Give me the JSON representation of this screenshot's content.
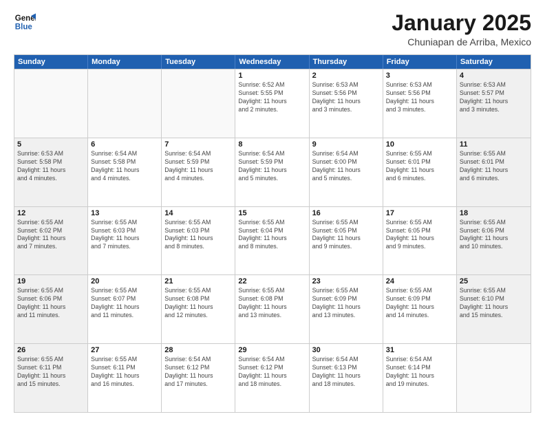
{
  "header": {
    "logo_line1": "General",
    "logo_line2": "Blue",
    "title": "January 2025",
    "subtitle": "Chuniapan de Arriba, Mexico"
  },
  "days_of_week": [
    "Sunday",
    "Monday",
    "Tuesday",
    "Wednesday",
    "Thursday",
    "Friday",
    "Saturday"
  ],
  "weeks": [
    [
      {
        "day": "",
        "info": "",
        "empty": true
      },
      {
        "day": "",
        "info": "",
        "empty": true
      },
      {
        "day": "",
        "info": "",
        "empty": true
      },
      {
        "day": "1",
        "info": "Sunrise: 6:52 AM\nSunset: 5:55 PM\nDaylight: 11 hours\nand 2 minutes."
      },
      {
        "day": "2",
        "info": "Sunrise: 6:53 AM\nSunset: 5:56 PM\nDaylight: 11 hours\nand 3 minutes."
      },
      {
        "day": "3",
        "info": "Sunrise: 6:53 AM\nSunset: 5:56 PM\nDaylight: 11 hours\nand 3 minutes."
      },
      {
        "day": "4",
        "info": "Sunrise: 6:53 AM\nSunset: 5:57 PM\nDaylight: 11 hours\nand 3 minutes."
      }
    ],
    [
      {
        "day": "5",
        "info": "Sunrise: 6:53 AM\nSunset: 5:58 PM\nDaylight: 11 hours\nand 4 minutes."
      },
      {
        "day": "6",
        "info": "Sunrise: 6:54 AM\nSunset: 5:58 PM\nDaylight: 11 hours\nand 4 minutes."
      },
      {
        "day": "7",
        "info": "Sunrise: 6:54 AM\nSunset: 5:59 PM\nDaylight: 11 hours\nand 4 minutes."
      },
      {
        "day": "8",
        "info": "Sunrise: 6:54 AM\nSunset: 5:59 PM\nDaylight: 11 hours\nand 5 minutes."
      },
      {
        "day": "9",
        "info": "Sunrise: 6:54 AM\nSunset: 6:00 PM\nDaylight: 11 hours\nand 5 minutes."
      },
      {
        "day": "10",
        "info": "Sunrise: 6:55 AM\nSunset: 6:01 PM\nDaylight: 11 hours\nand 6 minutes."
      },
      {
        "day": "11",
        "info": "Sunrise: 6:55 AM\nSunset: 6:01 PM\nDaylight: 11 hours\nand 6 minutes."
      }
    ],
    [
      {
        "day": "12",
        "info": "Sunrise: 6:55 AM\nSunset: 6:02 PM\nDaylight: 11 hours\nand 7 minutes."
      },
      {
        "day": "13",
        "info": "Sunrise: 6:55 AM\nSunset: 6:03 PM\nDaylight: 11 hours\nand 7 minutes."
      },
      {
        "day": "14",
        "info": "Sunrise: 6:55 AM\nSunset: 6:03 PM\nDaylight: 11 hours\nand 8 minutes."
      },
      {
        "day": "15",
        "info": "Sunrise: 6:55 AM\nSunset: 6:04 PM\nDaylight: 11 hours\nand 8 minutes."
      },
      {
        "day": "16",
        "info": "Sunrise: 6:55 AM\nSunset: 6:05 PM\nDaylight: 11 hours\nand 9 minutes."
      },
      {
        "day": "17",
        "info": "Sunrise: 6:55 AM\nSunset: 6:05 PM\nDaylight: 11 hours\nand 9 minutes."
      },
      {
        "day": "18",
        "info": "Sunrise: 6:55 AM\nSunset: 6:06 PM\nDaylight: 11 hours\nand 10 minutes."
      }
    ],
    [
      {
        "day": "19",
        "info": "Sunrise: 6:55 AM\nSunset: 6:06 PM\nDaylight: 11 hours\nand 11 minutes."
      },
      {
        "day": "20",
        "info": "Sunrise: 6:55 AM\nSunset: 6:07 PM\nDaylight: 11 hours\nand 11 minutes."
      },
      {
        "day": "21",
        "info": "Sunrise: 6:55 AM\nSunset: 6:08 PM\nDaylight: 11 hours\nand 12 minutes."
      },
      {
        "day": "22",
        "info": "Sunrise: 6:55 AM\nSunset: 6:08 PM\nDaylight: 11 hours\nand 13 minutes."
      },
      {
        "day": "23",
        "info": "Sunrise: 6:55 AM\nSunset: 6:09 PM\nDaylight: 11 hours\nand 13 minutes."
      },
      {
        "day": "24",
        "info": "Sunrise: 6:55 AM\nSunset: 6:09 PM\nDaylight: 11 hours\nand 14 minutes."
      },
      {
        "day": "25",
        "info": "Sunrise: 6:55 AM\nSunset: 6:10 PM\nDaylight: 11 hours\nand 15 minutes."
      }
    ],
    [
      {
        "day": "26",
        "info": "Sunrise: 6:55 AM\nSunset: 6:11 PM\nDaylight: 11 hours\nand 15 minutes."
      },
      {
        "day": "27",
        "info": "Sunrise: 6:55 AM\nSunset: 6:11 PM\nDaylight: 11 hours\nand 16 minutes."
      },
      {
        "day": "28",
        "info": "Sunrise: 6:54 AM\nSunset: 6:12 PM\nDaylight: 11 hours\nand 17 minutes."
      },
      {
        "day": "29",
        "info": "Sunrise: 6:54 AM\nSunset: 6:12 PM\nDaylight: 11 hours\nand 18 minutes."
      },
      {
        "day": "30",
        "info": "Sunrise: 6:54 AM\nSunset: 6:13 PM\nDaylight: 11 hours\nand 18 minutes."
      },
      {
        "day": "31",
        "info": "Sunrise: 6:54 AM\nSunset: 6:14 PM\nDaylight: 11 hours\nand 19 minutes."
      },
      {
        "day": "",
        "info": "",
        "empty": true
      }
    ]
  ]
}
